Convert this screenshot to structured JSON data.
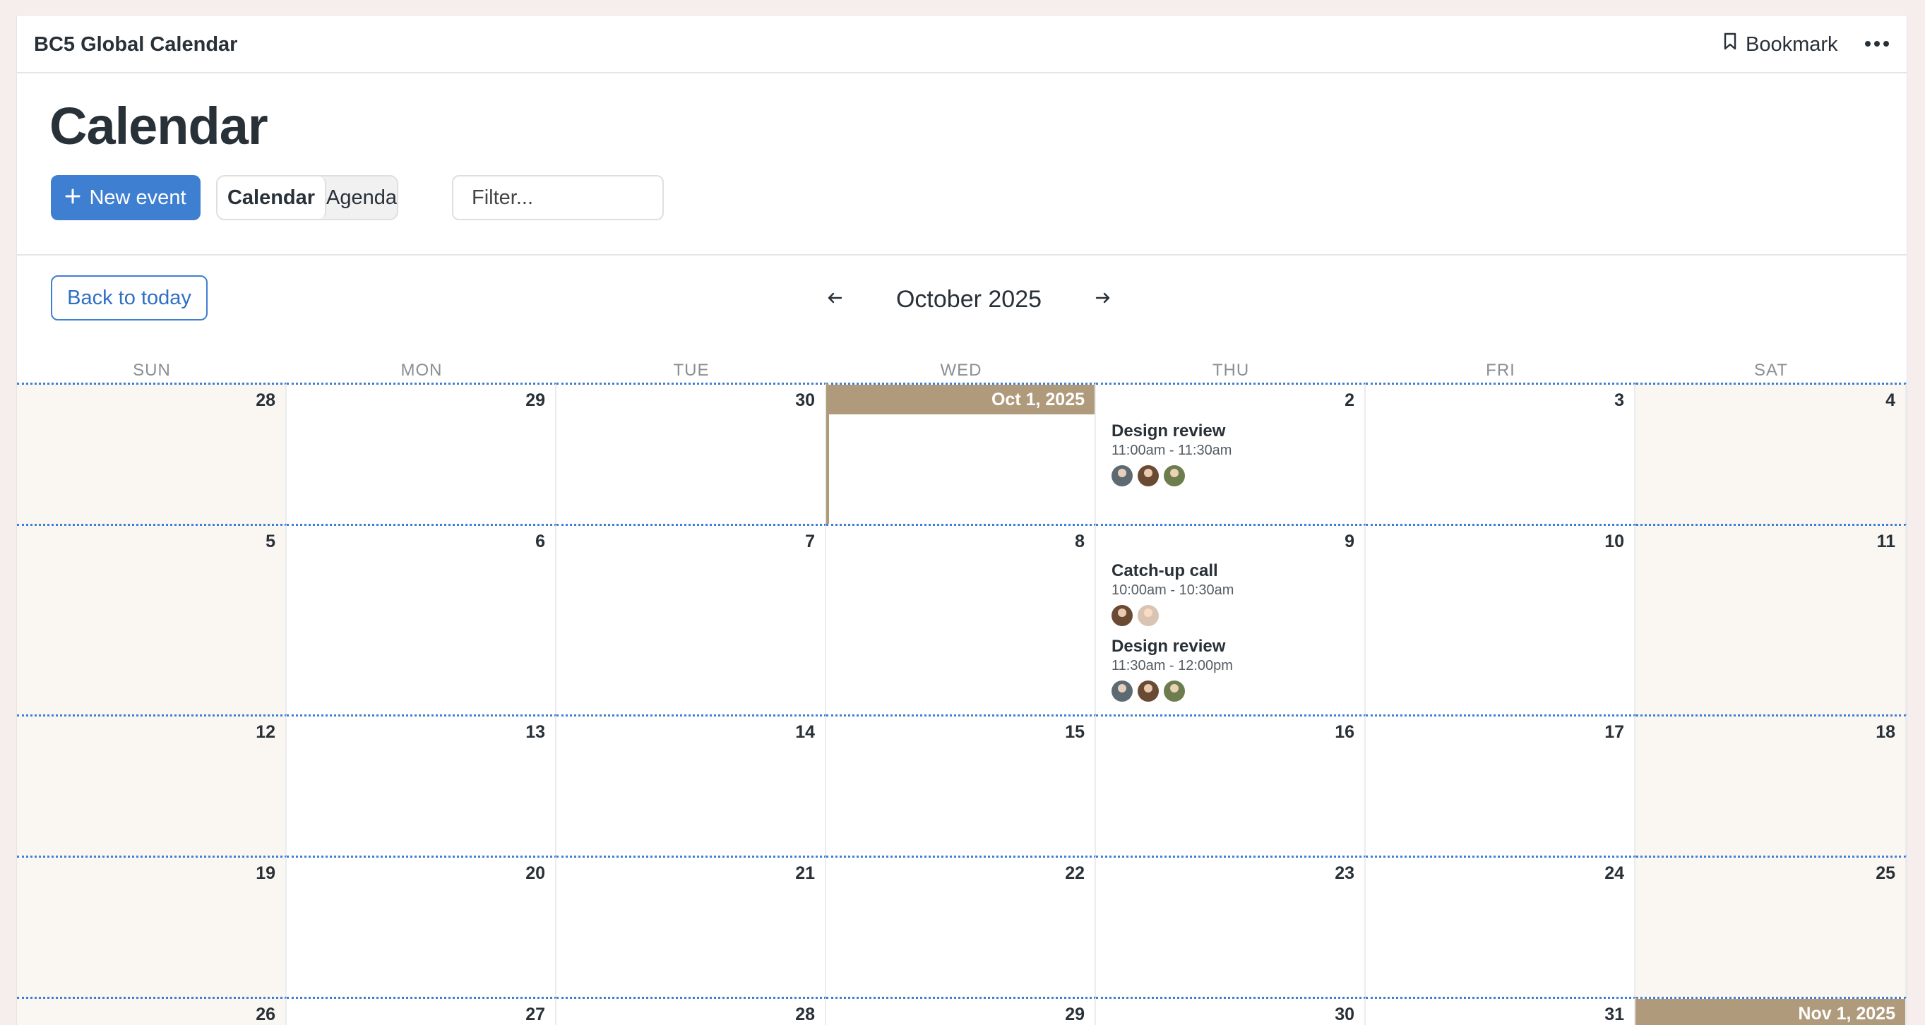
{
  "app": {
    "title": "BC5 Global Calendar",
    "bookmark_label": "Bookmark"
  },
  "header": {
    "title": "Calendar",
    "new_event_label": "New event",
    "view_calendar_label": "Calendar",
    "view_agenda_label": "Agenda",
    "filter_placeholder": "Filter..."
  },
  "nav": {
    "back_today_label": "Back to today",
    "month_label": "October 2025",
    "prev_arrow": "←",
    "next_arrow": "→"
  },
  "weekdays": [
    "SUN",
    "MON",
    "TUE",
    "WED",
    "THU",
    "FRI",
    "SAT"
  ],
  "weeks": [
    [
      "28",
      "29",
      "30",
      "Oct 1, 2025",
      "2",
      "3",
      "4"
    ],
    [
      "5",
      "6",
      "7",
      "8",
      "9",
      "10",
      "11"
    ],
    [
      "12",
      "13",
      "14",
      "15",
      "16",
      "17",
      "18"
    ],
    [
      "19",
      "20",
      "21",
      "22",
      "23",
      "24",
      "25"
    ],
    [
      "26",
      "27",
      "28",
      "29",
      "30",
      "31",
      "Nov 1, 2025"
    ]
  ],
  "events": [
    {
      "title": "Design review",
      "time": "11:00am - 11:30am"
    },
    {
      "title": "Catch-up call",
      "time": "10:00am - 10:30am"
    },
    {
      "title": "Design review",
      "time": "11:30am - 12:00pm"
    }
  ],
  "colors": {
    "accent": "#3f7fd1",
    "today_header": "#b09a7c",
    "weekend_bg": "#faf7f3",
    "avatar_1": "#5e6a72",
    "avatar_2": "#6b4a34",
    "avatar_3": "#6e7d4e",
    "avatar_4": "#d9c4b4"
  }
}
